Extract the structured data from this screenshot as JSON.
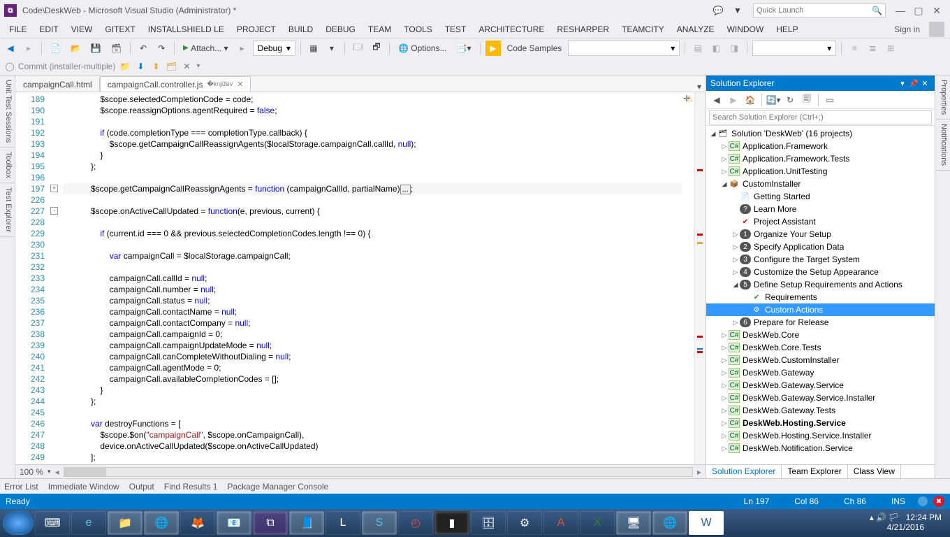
{
  "title": "Code\\DeskWeb - Microsoft Visual Studio  (Administrator) *",
  "quick_launch_placeholder": "Quick Launch",
  "menus": [
    "FILE",
    "EDIT",
    "VIEW",
    "GITEXT",
    "INSTALLSHIELD LE",
    "PROJECT",
    "BUILD",
    "DEBUG",
    "TEAM",
    "TOOLS",
    "TEST",
    "ARCHITECTURE",
    "RESHARPER",
    "TEAMCITY",
    "ANALYZE",
    "WINDOW",
    "HELP"
  ],
  "sign_in": "Sign in",
  "toolbar": {
    "attach": "Attach...",
    "config": "Debug",
    "options": "Options...",
    "code_samples": "Code Samples"
  },
  "commit_label": "Commit (installer-multiple)",
  "left_tabs": [
    "Unit Test Sessions",
    "Toolbox",
    "Test Explorer"
  ],
  "right_tabs": [
    "Properties",
    "Notifications"
  ],
  "editor_tabs": {
    "pinned": "campaignCall.html",
    "active": "campaignCall.controller.js"
  },
  "zoom": "100 %",
  "code_lines": [
    {
      "n": 189,
      "t": "                $scope.selectedCompletionCode = code;"
    },
    {
      "n": 190,
      "t": "                $scope.reassignOptions.agentRequired = <kw>false</kw>;"
    },
    {
      "n": 191,
      "t": ""
    },
    {
      "n": 192,
      "t": "                <kw>if</kw> (code.completionType === completionType.callback) {"
    },
    {
      "n": 193,
      "t": "                    $scope.getCampaignCallReassignAgents($localStorage.campaignCall.callId, <kw>null</kw>);"
    },
    {
      "n": 194,
      "t": "                }"
    },
    {
      "n": 195,
      "t": "            };"
    },
    {
      "n": 196,
      "t": ""
    },
    {
      "n": 197,
      "t": "            $scope.getCampaignCallReassignAgents = <kw>function</kw> (campaignCallId, partialName)<span class='box'>...</span>;",
      "hl": true,
      "fold": "+"
    },
    {
      "n": 226,
      "t": ""
    },
    {
      "n": 227,
      "t": "            $scope.onActiveCallUpdated = <kw>function</kw>(e, previous, current) {",
      "fold": "-"
    },
    {
      "n": 228,
      "t": ""
    },
    {
      "n": 229,
      "t": "                <kw>if</kw> (current.id === 0 && previous.selectedCompletionCodes.length !== 0) {"
    },
    {
      "n": 230,
      "t": ""
    },
    {
      "n": 231,
      "t": "                    <kw>var</kw> campaignCall = $localStorage.campaignCall;"
    },
    {
      "n": 232,
      "t": ""
    },
    {
      "n": 233,
      "t": "                    campaignCall.callId = <kw>null</kw>;"
    },
    {
      "n": 234,
      "t": "                    campaignCall.number = <kw>null</kw>;"
    },
    {
      "n": 235,
      "t": "                    campaignCall.status = <kw>null</kw>;"
    },
    {
      "n": 236,
      "t": "                    campaignCall.contactName = <kw>null</kw>;"
    },
    {
      "n": 237,
      "t": "                    campaignCall.contactCompany = <kw>null</kw>;"
    },
    {
      "n": 238,
      "t": "                    campaignCall.campaignId = 0;"
    },
    {
      "n": 239,
      "t": "                    campaignCall.campaignUpdateMode = <kw>null</kw>;"
    },
    {
      "n": 240,
      "t": "                    campaignCall.canCompleteWithoutDialing = <kw>null</kw>;"
    },
    {
      "n": 241,
      "t": "                    campaignCall.agentMode = 0;"
    },
    {
      "n": 242,
      "t": "                    campaignCall.availableCompletionCodes = [];"
    },
    {
      "n": 243,
      "t": "                }"
    },
    {
      "n": 244,
      "t": "            };"
    },
    {
      "n": 245,
      "t": ""
    },
    {
      "n": 246,
      "t": "            <kw>var</kw> destroyFunctions = ["
    },
    {
      "n": 247,
      "t": "                $scope.$on(<span class='str'>\"campaignCall\"</span>, $scope.onCampaignCall),"
    },
    {
      "n": 248,
      "t": "                device.onActiveCallUpdated($scope.onActiveCallUpdated)"
    },
    {
      "n": 249,
      "t": "            ];"
    }
  ],
  "solution": {
    "title": "Solution Explorer",
    "search_placeholder": "Search Solution Explorer (Ctrl+;)",
    "root": "Solution 'DeskWeb' (16 projects)",
    "items": [
      {
        "indent": 1,
        "arrow": "▷",
        "icon": "cs",
        "text": "Application.Framework"
      },
      {
        "indent": 1,
        "arrow": "▷",
        "icon": "cs",
        "text": "Application.Framework.Tests"
      },
      {
        "indent": 1,
        "arrow": "▷",
        "icon": "cs",
        "text": "Application.UnitTesting"
      },
      {
        "indent": 1,
        "arrow": "◢",
        "icon": "ci",
        "text": "CustomInstaller"
      },
      {
        "indent": 2,
        "arrow": "",
        "icon": "doc",
        "text": "Getting Started"
      },
      {
        "indent": 2,
        "arrow": "",
        "icon": "q",
        "text": "Learn More"
      },
      {
        "indent": 2,
        "arrow": "",
        "icon": "chk",
        "text": "Project Assistant"
      },
      {
        "indent": 2,
        "arrow": "▷",
        "icon": "n1",
        "text": "Organize Your Setup"
      },
      {
        "indent": 2,
        "arrow": "▷",
        "icon": "n2",
        "text": "Specify Application Data"
      },
      {
        "indent": 2,
        "arrow": "▷",
        "icon": "n3",
        "text": "Configure the Target System"
      },
      {
        "indent": 2,
        "arrow": "▷",
        "icon": "n4",
        "text": "Customize the Setup Appearance"
      },
      {
        "indent": 2,
        "arrow": "◢",
        "icon": "n5",
        "text": "Define Setup Requirements and Actions"
      },
      {
        "indent": 3,
        "arrow": "",
        "icon": "req",
        "text": "Requirements"
      },
      {
        "indent": 3,
        "arrow": "",
        "icon": "ca",
        "text": "Custom Actions",
        "selected": true
      },
      {
        "indent": 2,
        "arrow": "▷",
        "icon": "n6",
        "text": "Prepare for Release"
      },
      {
        "indent": 1,
        "arrow": "▷",
        "icon": "cs",
        "text": "DeskWeb.Core"
      },
      {
        "indent": 1,
        "arrow": "▷",
        "icon": "cs",
        "text": "DeskWeb.Core.Tests"
      },
      {
        "indent": 1,
        "arrow": "▷",
        "icon": "cs",
        "text": "DeskWeb.CustomInstaller"
      },
      {
        "indent": 1,
        "arrow": "▷",
        "icon": "cs",
        "text": "DeskWeb.Gateway"
      },
      {
        "indent": 1,
        "arrow": "▷",
        "icon": "cs",
        "text": "DeskWeb.Gateway.Service"
      },
      {
        "indent": 1,
        "arrow": "▷",
        "icon": "cs",
        "text": "DeskWeb.Gateway.Service.Installer"
      },
      {
        "indent": 1,
        "arrow": "▷",
        "icon": "cs",
        "text": "DeskWeb.Gateway.Tests"
      },
      {
        "indent": 1,
        "arrow": "▷",
        "icon": "cs",
        "text": "DeskWeb.Hosting.Service",
        "bold": true
      },
      {
        "indent": 1,
        "arrow": "▷",
        "icon": "cs",
        "text": "DeskWeb.Hosting.Service.Installer"
      },
      {
        "indent": 1,
        "arrow": "▷",
        "icon": "cs",
        "text": "DeskWeb.Notification.Service"
      }
    ],
    "tabs": [
      "Solution Explorer",
      "Team Explorer",
      "Class View"
    ]
  },
  "bottom_tabs": [
    "Error List",
    "Immediate Window",
    "Output",
    "Find Results 1",
    "Package Manager Console"
  ],
  "status": {
    "ready": "Ready",
    "ln": "Ln 197",
    "col": "Col 86",
    "ch": "Ch 86",
    "ins": "INS"
  },
  "clock": {
    "time": "12:24 PM",
    "date": "4/21/2016"
  }
}
